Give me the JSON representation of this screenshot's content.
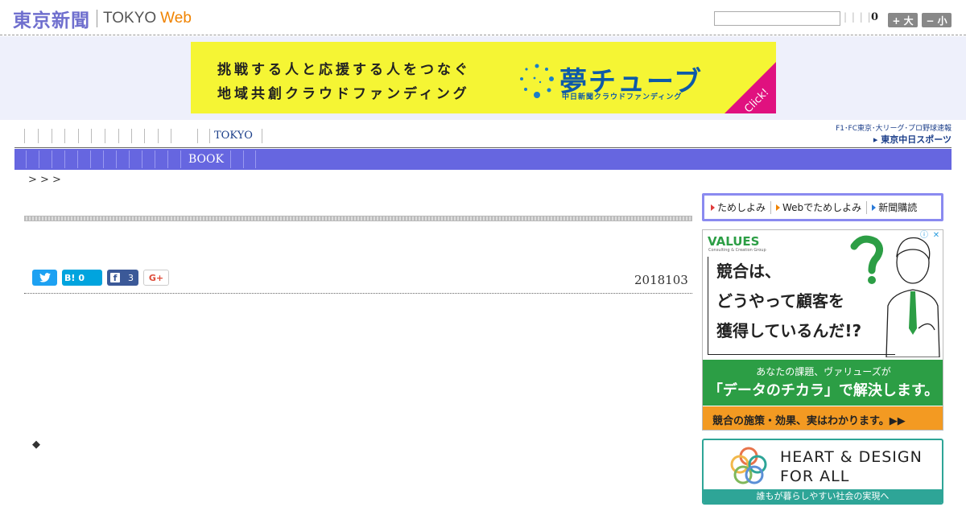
{
  "header": {
    "logo_jp": "東京新聞",
    "logo_en": "TOKYO",
    "logo_web": "Web",
    "search_placeholder": "",
    "separators": "| | | |",
    "count": "0",
    "font_larger": "+ 大",
    "font_smaller": "− 小"
  },
  "banner": {
    "line1": "挑戦する人と応援する人をつなぐ",
    "line2": "地域共創クラウドファンディング",
    "brand": "夢チューブ",
    "brand_sub": "中日新聞クラウドファンディング",
    "click": "Click!"
  },
  "nav": {
    "top_label": "TOKYO",
    "bar_label": "BOOK",
    "chunichi_line1": "F1･FC東京･大リーグ･プロ野球速報",
    "chunichi_line2": "▸ 東京中日スポーツ"
  },
  "breadcrumb": ">    > >",
  "article": {
    "share_hatena_count": "0",
    "share_facebook_count": "3",
    "share_gplus": "G+",
    "date": "2018103",
    "diamond": "◆"
  },
  "sidebar": {
    "trial": [
      "ためしよみ",
      "Webでためしよみ",
      "新聞購読"
    ],
    "values_ad": {
      "logo": "VALUES",
      "logo_sub": "Consulting & Creation Group",
      "headline": [
        "競合は、",
        "どうやって顧客を",
        "獲得しているんだ!?"
      ],
      "green_line1": "あなたの課題、ヴァリューズが",
      "green_line2": "「データのチカラ」で解決します。",
      "orange": "競合の施策・効果、実はわかります。▶▶"
    },
    "heart_ad": {
      "line1": "HEART & DESIGN",
      "line2": "FOR ALL",
      "bar": "誰もが暮らしやすい社会の実現へ"
    }
  },
  "colors": {
    "brand": "#6f6fce",
    "web_orange": "#f08300",
    "nav_bar": "#6666e0",
    "banner_yellow": "#f5f534",
    "values_green": "#2c9e45",
    "values_orange": "#f39a22",
    "heart_teal": "#2ea597"
  }
}
